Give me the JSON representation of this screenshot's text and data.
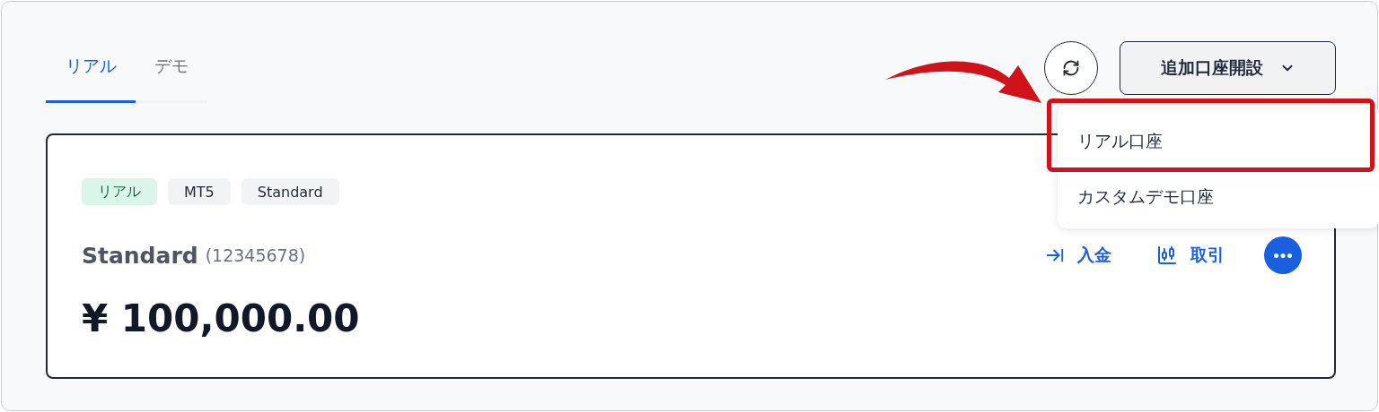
{
  "tabs": [
    {
      "label": "リアル",
      "selected": true
    },
    {
      "label": "デモ",
      "selected": false
    }
  ],
  "open_account_button": {
    "label": "追加口座開設"
  },
  "menu": [
    {
      "label": "リアル口座",
      "marked": true
    },
    {
      "label": "カスタムデモ口座",
      "marked": false
    }
  ],
  "account": {
    "tags": [
      {
        "label": "リアル",
        "kind": "real"
      },
      {
        "label": "MT5",
        "kind": "plain"
      },
      {
        "label": "Standard",
        "kind": "plain"
      }
    ],
    "name": "Standard",
    "number": "(12345678)",
    "balance": "¥ 100,000.00",
    "actions": [
      {
        "label": "入金",
        "kind": "deposit"
      },
      {
        "label": "取引",
        "kind": "trade"
      }
    ]
  }
}
